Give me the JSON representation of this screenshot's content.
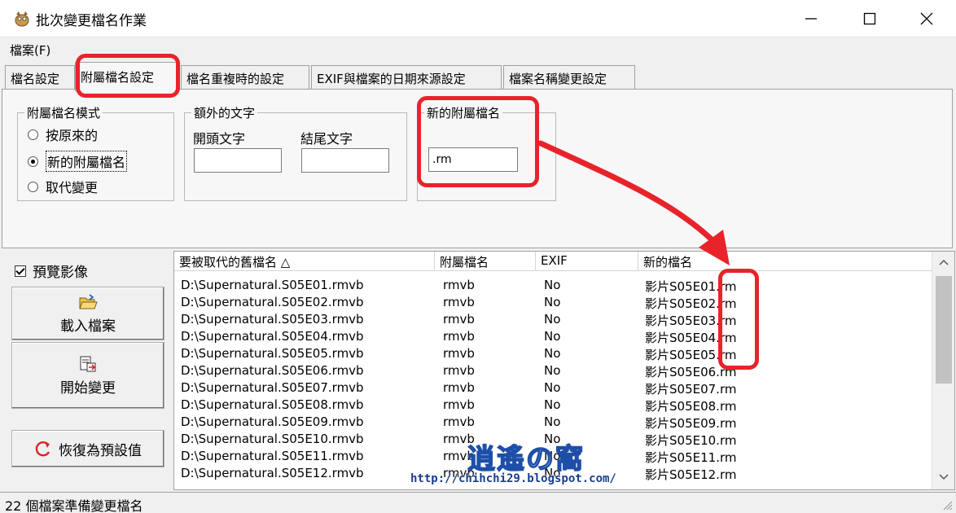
{
  "window": {
    "title": "批次變更檔名作業"
  },
  "menu": {
    "file": "檔案(F)"
  },
  "tabs": [
    {
      "label": "檔名設定"
    },
    {
      "label": "附屬檔名設定"
    },
    {
      "label": "檔名重複時的設定"
    },
    {
      "label": "EXIF與檔案的日期來源設定"
    },
    {
      "label": "檔案名稱變更設定"
    }
  ],
  "extension_mode": {
    "title": "附屬檔名模式",
    "options": [
      {
        "label": "按原來的",
        "checked": false
      },
      {
        "label": "新的附屬檔名",
        "checked": true
      },
      {
        "label": "取代變更",
        "checked": false
      }
    ]
  },
  "extra_text": {
    "title": "額外的文字",
    "prefix_label": "開頭文字",
    "prefix_value": "",
    "suffix_label": "結尾文字",
    "suffix_value": ""
  },
  "new_extension": {
    "title": "新的附屬檔名",
    "value": ".rm"
  },
  "left_panel": {
    "preview_label": "預覽影像",
    "preview_checked": true,
    "load_button": "載入檔案",
    "start_button": "開始變更",
    "reset_button": "恢復為預設值"
  },
  "list": {
    "columns": [
      "要被取代的舊檔名 △",
      "附屬檔名",
      "EXIF",
      "新的檔名"
    ],
    "rows": [
      {
        "old": "D:\\Supernatural.S05E01.rmvb",
        "ext": "rmvb",
        "exif": "No",
        "new": "影片S05E01.rm"
      },
      {
        "old": "D:\\Supernatural.S05E02.rmvb",
        "ext": "rmvb",
        "exif": "No",
        "new": "影片S05E02.rm"
      },
      {
        "old": "D:\\Supernatural.S05E03.rmvb",
        "ext": "rmvb",
        "exif": "No",
        "new": "影片S05E03.rm"
      },
      {
        "old": "D:\\Supernatural.S05E04.rmvb",
        "ext": "rmvb",
        "exif": "No",
        "new": "影片S05E04.rm"
      },
      {
        "old": "D:\\Supernatural.S05E05.rmvb",
        "ext": "rmvb",
        "exif": "No",
        "new": "影片S05E05.rm"
      },
      {
        "old": "D:\\Supernatural.S05E06.rmvb",
        "ext": "rmvb",
        "exif": "No",
        "new": "影片S05E06.rm"
      },
      {
        "old": "D:\\Supernatural.S05E07.rmvb",
        "ext": "rmvb",
        "exif": "No",
        "new": "影片S05E07.rm"
      },
      {
        "old": "D:\\Supernatural.S05E08.rmvb",
        "ext": "rmvb",
        "exif": "No",
        "new": "影片S05E08.rm"
      },
      {
        "old": "D:\\Supernatural.S05E09.rmvb",
        "ext": "rmvb",
        "exif": "No",
        "new": "影片S05E09.rm"
      },
      {
        "old": "D:\\Supernatural.S05E10.rmvb",
        "ext": "rmvb",
        "exif": "No",
        "new": "影片S05E10.rm"
      },
      {
        "old": "D:\\Supernatural.S05E11.rmvb",
        "ext": "rmvb",
        "exif": "No",
        "new": "影片S05E11.rm"
      },
      {
        "old": "D:\\Supernatural.S05E12.rmvb",
        "ext": "rmvb",
        "exif": "No",
        "new": "影片S05E12.rm"
      }
    ]
  },
  "watermark": {
    "name": "逍遙の窩",
    "url": "http://chihchi29.blogspot.com/"
  },
  "status": {
    "text": "22 個檔案準備變更檔名"
  },
  "colors": {
    "highlight": "#e8232a",
    "watermark": "#1e4fa8"
  }
}
